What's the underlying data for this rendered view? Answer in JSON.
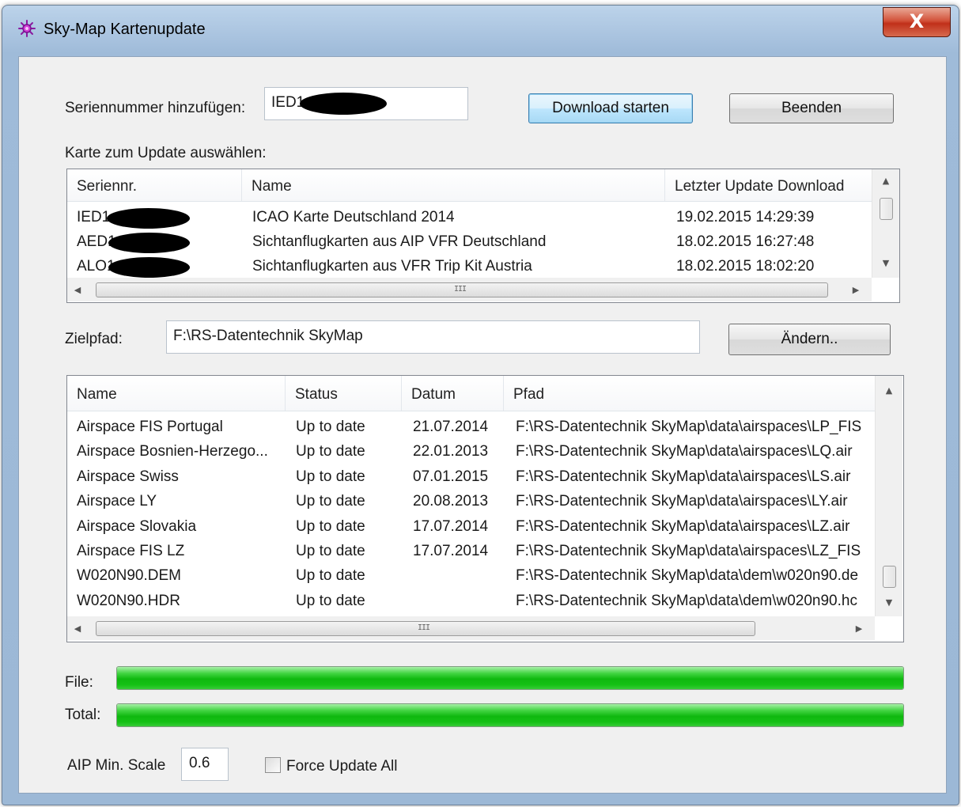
{
  "window": {
    "title": "Sky-Map Kartenupdate",
    "close_glyph": "X",
    "app_icon": "star-icon"
  },
  "serial": {
    "label": "Seriennummer hinzufügen:",
    "value": "IED1"
  },
  "buttons": {
    "download": "Download starten",
    "quit": "Beenden",
    "change": "Ändern.."
  },
  "maps": {
    "label": "Karte zum Update auswählen:",
    "columns": [
      "Seriennr.",
      "Name",
      "Letzter Update Download"
    ],
    "rows": [
      {
        "serial": "IED1",
        "name": "ICAO Karte Deutschland 2014",
        "date": "19.02.2015 14:29:39"
      },
      {
        "serial": "AED1",
        "name": "Sichtanflugkarten aus AIP VFR Deutschland",
        "date": "18.02.2015 16:27:48"
      },
      {
        "serial": "ALO1",
        "name": "Sichtanflugkarten aus VFR Trip Kit Austria",
        "date": "18.02.2015 18:02:20"
      }
    ]
  },
  "target": {
    "label": "Zielpfad:",
    "value": "F:\\RS-Datentechnik SkyMap"
  },
  "files": {
    "columns": [
      "Name",
      "Status",
      "Datum",
      "Pfad"
    ],
    "rows": [
      {
        "name": "Airspace FIS Portugal",
        "status": "Up to date",
        "date": "21.07.2014",
        "path": "F:\\RS-Datentechnik SkyMap\\data\\airspaces\\LP_FIS"
      },
      {
        "name": "Airspace Bosnien-Herzego...",
        "status": "Up to date",
        "date": "22.01.2013",
        "path": "F:\\RS-Datentechnik SkyMap\\data\\airspaces\\LQ.air"
      },
      {
        "name": "Airspace Swiss",
        "status": "Up to date",
        "date": "07.01.2015",
        "path": "F:\\RS-Datentechnik SkyMap\\data\\airspaces\\LS.air"
      },
      {
        "name": "Airspace LY",
        "status": "Up to date",
        "date": "20.08.2013",
        "path": "F:\\RS-Datentechnik SkyMap\\data\\airspaces\\LY.air"
      },
      {
        "name": "Airspace Slovakia",
        "status": "Up to date",
        "date": "17.07.2014",
        "path": "F:\\RS-Datentechnik SkyMap\\data\\airspaces\\LZ.air"
      },
      {
        "name": "Airspace FIS LZ",
        "status": "Up to date",
        "date": "17.07.2014",
        "path": "F:\\RS-Datentechnik SkyMap\\data\\airspaces\\LZ_FIS"
      },
      {
        "name": "W020N90.DEM",
        "status": "Up to date",
        "date": "",
        "path": "F:\\RS-Datentechnik SkyMap\\data\\dem\\w020n90.de"
      },
      {
        "name": "W020N90.HDR",
        "status": "Up to date",
        "date": "",
        "path": "F:\\RS-Datentechnik SkyMap\\data\\dem\\w020n90.hc"
      }
    ]
  },
  "progress": {
    "file_label": "File:",
    "file_value": 1.0,
    "total_label": "Total:",
    "total_value": 1.0,
    "color": "#18c018"
  },
  "options": {
    "scale_label": "AIP Min. Scale",
    "scale_value": "0.6",
    "force_label": "Force Update All",
    "force_checked": false
  },
  "scroll_glyphs": {
    "up": "▲",
    "down": "▼",
    "left": "◀",
    "right": "▶",
    "grip": "III"
  }
}
